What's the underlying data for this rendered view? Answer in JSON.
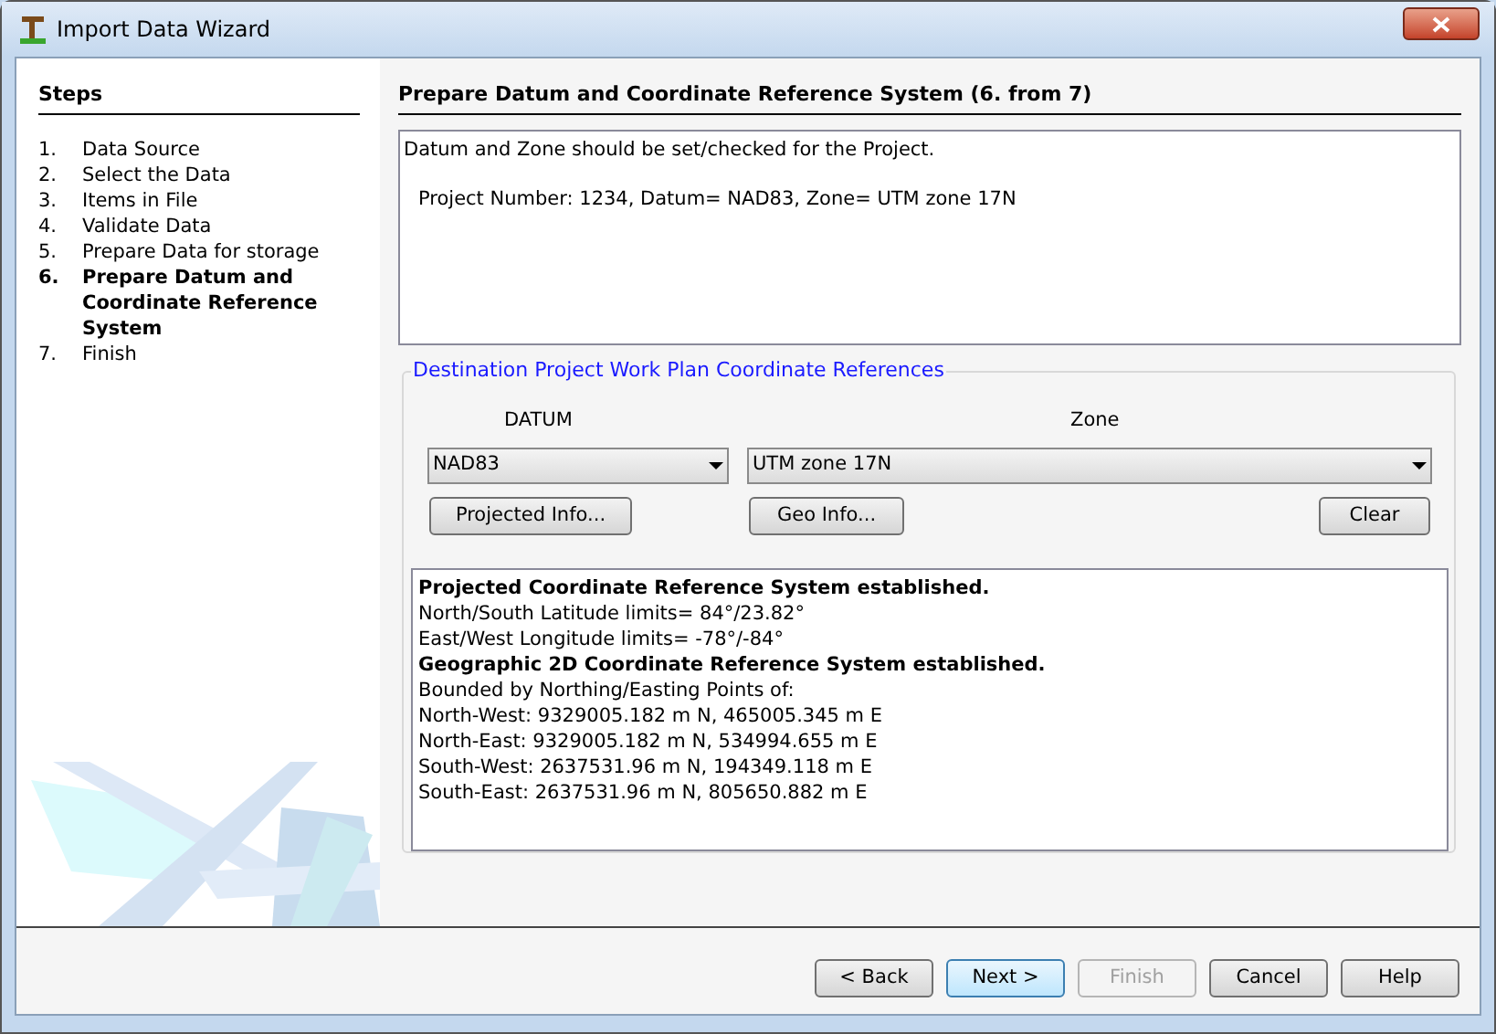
{
  "window": {
    "title": "Import Data Wizard"
  },
  "steps": {
    "heading": "Steps",
    "items": [
      {
        "number": "1.",
        "label": "Data Source",
        "selected": false
      },
      {
        "number": "2.",
        "label": "Select the Data",
        "selected": false
      },
      {
        "number": "3.",
        "label": "Items in File",
        "selected": false
      },
      {
        "number": "4.",
        "label": "Validate Data",
        "selected": false
      },
      {
        "number": "5.",
        "label": "Prepare Data for storage",
        "selected": false
      },
      {
        "number": "6.",
        "label": "Prepare Datum and Coordinate Reference System",
        "selected": true
      },
      {
        "number": "7.",
        "label": "Finish",
        "selected": false
      }
    ]
  },
  "page": {
    "heading": "Prepare Datum and Coordinate Reference System (6. from 7)",
    "intro": [
      "Datum and Zone should be set/checked for the Project.",
      "Project Number: 1234, Datum= NAD83, Zone= UTM zone 17N"
    ],
    "group": {
      "legend": "Destination Project Work Plan Coordinate References",
      "datum": {
        "label": "DATUM",
        "value": "NAD83"
      },
      "zone": {
        "label": "Zone",
        "value": "UTM zone 17N"
      },
      "buttons": [
        "Projected Info...",
        "Geo Info...",
        "Clear"
      ],
      "info": [
        {
          "text": "Projected Coordinate Reference System established.",
          "bold": true
        },
        {
          "text": "North/South Latitude limits= 84°/23.82°",
          "bold": false
        },
        {
          "text": "East/West Longitude limits= -78°/-84°",
          "bold": false
        },
        {
          "text": "Geographic 2D Coordinate Reference System established.",
          "bold": true
        },
        {
          "text": "Bounded by Northing/Easting Points of:",
          "bold": false
        },
        {
          "text": "North-West: 9329005.182 m N, 465005.345 m E",
          "bold": false
        },
        {
          "text": "North-East: 9329005.182 m N, 534994.655 m E",
          "bold": false
        },
        {
          "text": "South-West: 2637531.96 m N, 194349.118 m E",
          "bold": false
        },
        {
          "text": "South-East: 2637531.96 m N, 805650.882 m E",
          "bold": false
        }
      ]
    }
  },
  "footer": {
    "buttons": [
      {
        "label": "< Back",
        "default": false,
        "disabled": false
      },
      {
        "label": "Next >",
        "default": true,
        "disabled": false
      },
      {
        "label": "Finish",
        "default": false,
        "disabled": true
      },
      {
        "label": "Cancel",
        "default": false,
        "disabled": false
      },
      {
        "label": "Help",
        "default": false,
        "disabled": false
      }
    ]
  }
}
